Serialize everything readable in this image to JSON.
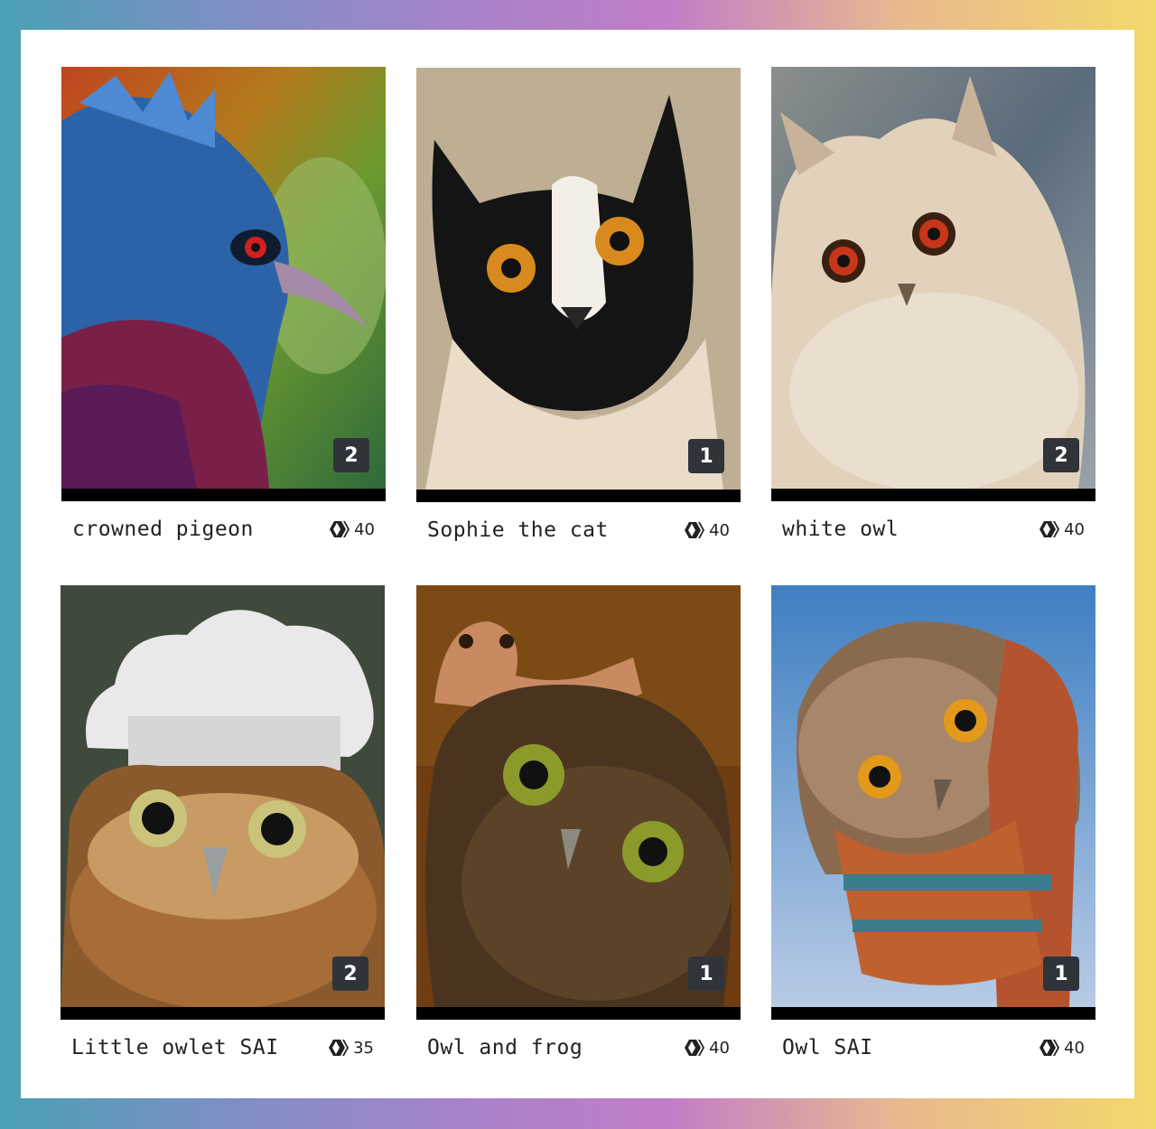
{
  "colors": {
    "frame_gradient": [
      "#4aa0b4",
      "#a882c9",
      "#c27ec7",
      "#f3d86a"
    ],
    "panel": "#ffffff",
    "badge_bg": "#2f343b",
    "text": "#222222"
  },
  "currency_icon": "hive-icon",
  "cards": [
    {
      "title": "crowned pigeon",
      "count": "2",
      "price": "40"
    },
    {
      "title": "Sophie the cat",
      "count": "1",
      "price": "40"
    },
    {
      "title": "white owl",
      "count": "2",
      "price": "40"
    },
    {
      "title": "Little owlet SAI",
      "count": "2",
      "price": "35"
    },
    {
      "title": "Owl and frog",
      "count": "1",
      "price": "40"
    },
    {
      "title": "Owl SAI",
      "count": "1",
      "price": "40"
    }
  ]
}
